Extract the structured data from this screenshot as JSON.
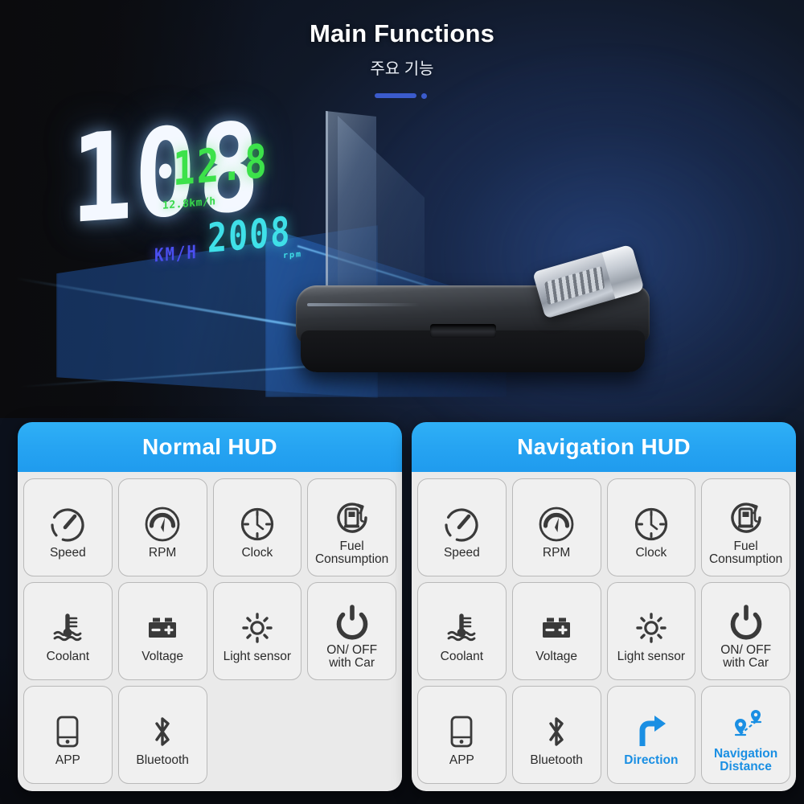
{
  "header": {
    "title": "Main Functions",
    "subtitle": "주요 기능"
  },
  "hud_display": {
    "speed_value": "108",
    "speed_unit": "KM/H",
    "secondary_value": "12.8",
    "secondary_label": "12.8km/h",
    "tertiary_value": "2008",
    "tertiary_suffix": "rpm"
  },
  "colors": {
    "accent_blue": "#26a4f2",
    "nav_blue": "#1a8fe3",
    "divider_blue": "#3b5bcc",
    "panel_body": "#eaeaea",
    "tile_bg": "#f0f0f0",
    "tile_border": "#b9b9b9",
    "hud_white": "#f4f8ff",
    "hud_green": "#3ce24a",
    "hud_cyan": "#3fe0e8",
    "hud_violet": "#4a4ff0",
    "background_dark": "#0d0d0f",
    "background_navy": "#16203a"
  },
  "panels": [
    {
      "id": "normal-hud",
      "title": "Normal HUD",
      "features": [
        {
          "icon": "speedometer-icon",
          "label": "Speed",
          "nav_exclusive": false
        },
        {
          "icon": "tachometer-icon",
          "label": "RPM",
          "nav_exclusive": false
        },
        {
          "icon": "clock-icon",
          "label": "Clock",
          "nav_exclusive": false
        },
        {
          "icon": "fuel-pump-icon",
          "label": "Fuel\nConsumption",
          "nav_exclusive": false
        },
        {
          "icon": "coolant-temp-icon",
          "label": "Coolant",
          "nav_exclusive": false
        },
        {
          "icon": "battery-icon",
          "label": "Voltage",
          "nav_exclusive": false
        },
        {
          "icon": "sun-icon",
          "label": "Light sensor",
          "nav_exclusive": false
        },
        {
          "icon": "power-icon",
          "label": "ON/ OFF\nwith Car",
          "nav_exclusive": false
        },
        {
          "icon": "phone-app-icon",
          "label": "APP",
          "nav_exclusive": false
        },
        {
          "icon": "bluetooth-icon",
          "label": "Bluetooth",
          "nav_exclusive": false
        }
      ]
    },
    {
      "id": "navigation-hud",
      "title": "Navigation HUD",
      "features": [
        {
          "icon": "speedometer-icon",
          "label": "Speed",
          "nav_exclusive": false
        },
        {
          "icon": "tachometer-icon",
          "label": "RPM",
          "nav_exclusive": false
        },
        {
          "icon": "clock-icon",
          "label": "Clock",
          "nav_exclusive": false
        },
        {
          "icon": "fuel-pump-icon",
          "label": "Fuel\nConsumption",
          "nav_exclusive": false
        },
        {
          "icon": "coolant-temp-icon",
          "label": "Coolant",
          "nav_exclusive": false
        },
        {
          "icon": "battery-icon",
          "label": "Voltage",
          "nav_exclusive": false
        },
        {
          "icon": "sun-icon",
          "label": "Light sensor",
          "nav_exclusive": false
        },
        {
          "icon": "power-icon",
          "label": "ON/ OFF\nwith Car",
          "nav_exclusive": false
        },
        {
          "icon": "phone-app-icon",
          "label": "APP",
          "nav_exclusive": false
        },
        {
          "icon": "bluetooth-icon",
          "label": "Bluetooth",
          "nav_exclusive": false
        },
        {
          "icon": "turn-right-arrow-icon",
          "label": "Direction",
          "nav_exclusive": true
        },
        {
          "icon": "map-pins-icon",
          "label": "Navigation\nDistance",
          "nav_exclusive": true
        }
      ]
    }
  ]
}
